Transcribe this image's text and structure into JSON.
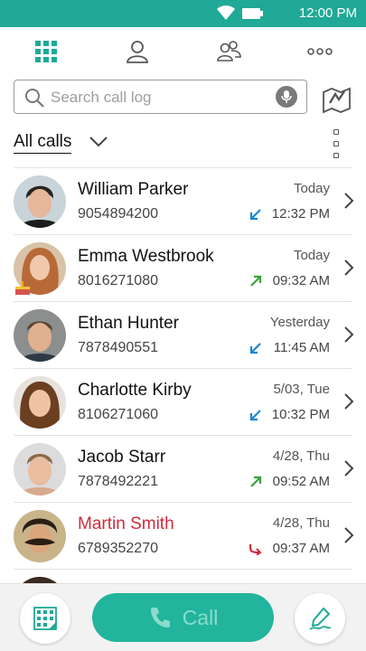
{
  "status_bar": {
    "time": "12:00 PM",
    "color": "#1fa996"
  },
  "tabs": [
    {
      "icon": "dialpad-grid-icon",
      "active": true
    },
    {
      "icon": "person-icon",
      "active": false
    },
    {
      "icon": "group-icon",
      "active": false
    },
    {
      "icon": "more-dots-icon",
      "active": false
    }
  ],
  "search": {
    "placeholder": "Search call log"
  },
  "filter": {
    "label": "All calls"
  },
  "calls": [
    {
      "name": "William Parker",
      "number": "9054894200",
      "date": "Today",
      "time": "12:32 PM",
      "direction": "incoming",
      "missed": false,
      "avatar": "man-dark-hair"
    },
    {
      "name": "Emma Westbrook",
      "number": "8016271080",
      "date": "Today",
      "time": "09:32 AM",
      "direction": "outgoing",
      "missed": false,
      "avatar": "woman-red-hair"
    },
    {
      "name": "Ethan Hunter",
      "number": "7878490551",
      "date": "Yesterday",
      "time": "11:45 AM",
      "direction": "incoming",
      "missed": false,
      "avatar": "man-short-hair"
    },
    {
      "name": "Charlotte Kirby",
      "number": "8106271060",
      "date": "5/03, Tue",
      "time": "10:32 PM",
      "direction": "incoming",
      "missed": false,
      "avatar": "woman-brown-hair"
    },
    {
      "name": "Jacob Starr",
      "number": "7878492221",
      "date": "4/28, Thu",
      "time": "09:52 AM",
      "direction": "outgoing",
      "missed": false,
      "avatar": "man-light-hair"
    },
    {
      "name": "Martin Smith",
      "number": "6789352270",
      "date": "4/28, Thu",
      "time": "09:37 AM",
      "direction": "missed",
      "missed": true,
      "avatar": "man-mustache"
    }
  ],
  "bottom_bar": {
    "call_label": "Call"
  },
  "colors": {
    "accent": "#22b49c",
    "missed": "#d22a3c",
    "incoming": "#1b87d4",
    "outgoing": "#3aa43a"
  }
}
